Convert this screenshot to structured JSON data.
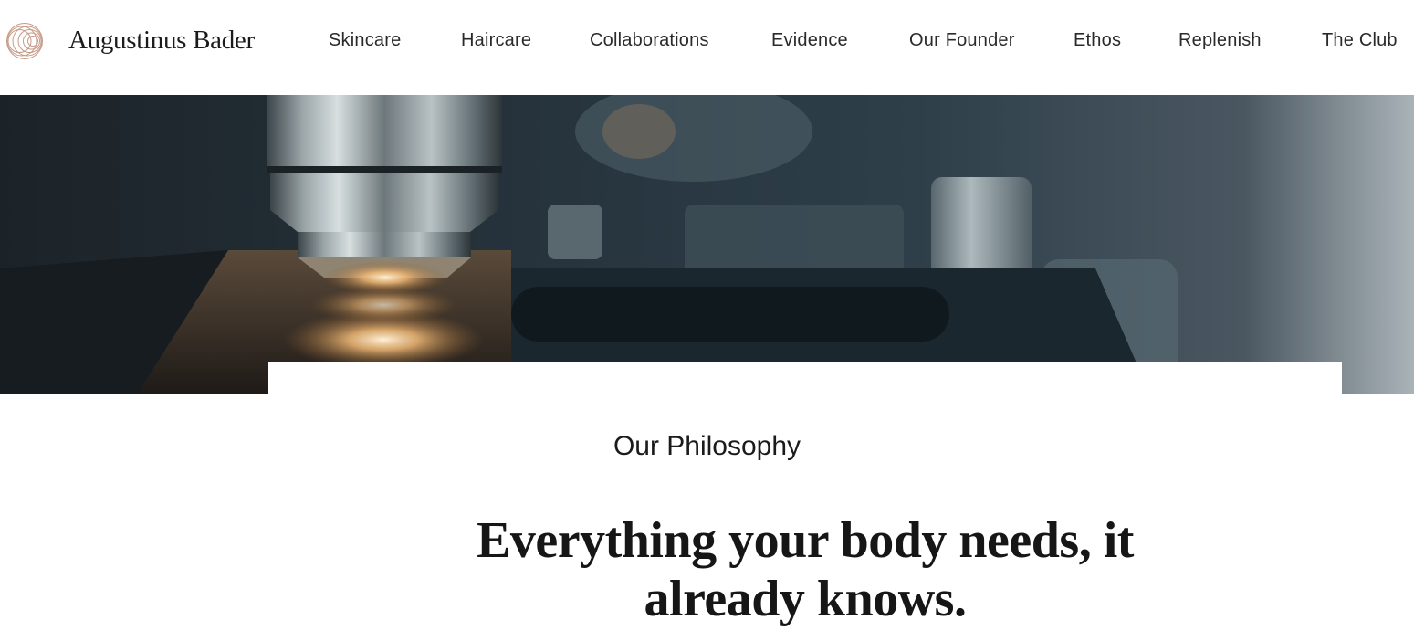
{
  "brand": {
    "name": "Augustinus Bader",
    "logo_icon": "concentric-circles-logo-icon",
    "accent_color": "#c79a86"
  },
  "nav": {
    "items": [
      {
        "label": "Skincare"
      },
      {
        "label": "Haircare"
      },
      {
        "label": "Collaborations"
      },
      {
        "label": "Evidence"
      },
      {
        "label": "Our Founder"
      },
      {
        "label": "Ethos"
      },
      {
        "label": "Replenish"
      },
      {
        "label": "The Club"
      }
    ]
  },
  "hero": {
    "image_subject": "microscope-image"
  },
  "philosophy": {
    "eyebrow": "Our Philosophy",
    "headline": "Everything your body needs, it already knows."
  }
}
